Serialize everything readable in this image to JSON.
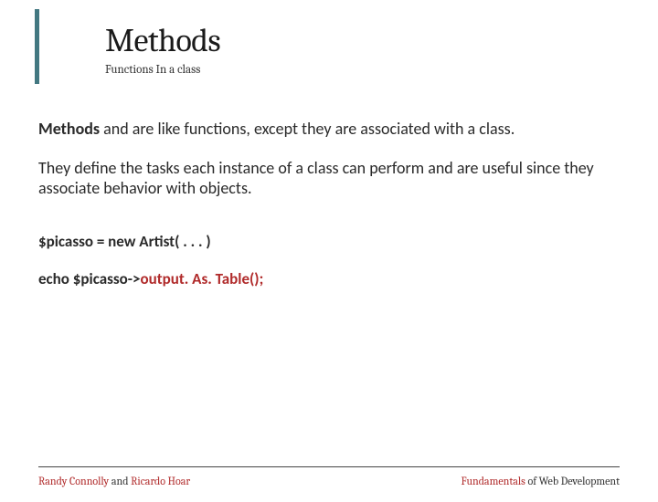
{
  "header": {
    "title": "Methods",
    "subtitle": "Functions In a class"
  },
  "body": {
    "para1_bold": "Methods",
    "para1_rest": " and are like functions, except they are associated with a class.",
    "para2": "They define the tasks each instance of a class can perform and are useful since they associate behavior with objects.",
    "code1": "$picasso = new Artist( . . . )",
    "code2_prefix": "echo $picasso->",
    "code2_method": "output. As. Table();"
  },
  "footer": {
    "left_a": "Randy Connolly",
    "left_mid": " and ",
    "left_b": "Ricardo Hoar",
    "right_a": "Fundamentals",
    "right_rest": " of Web Development"
  }
}
